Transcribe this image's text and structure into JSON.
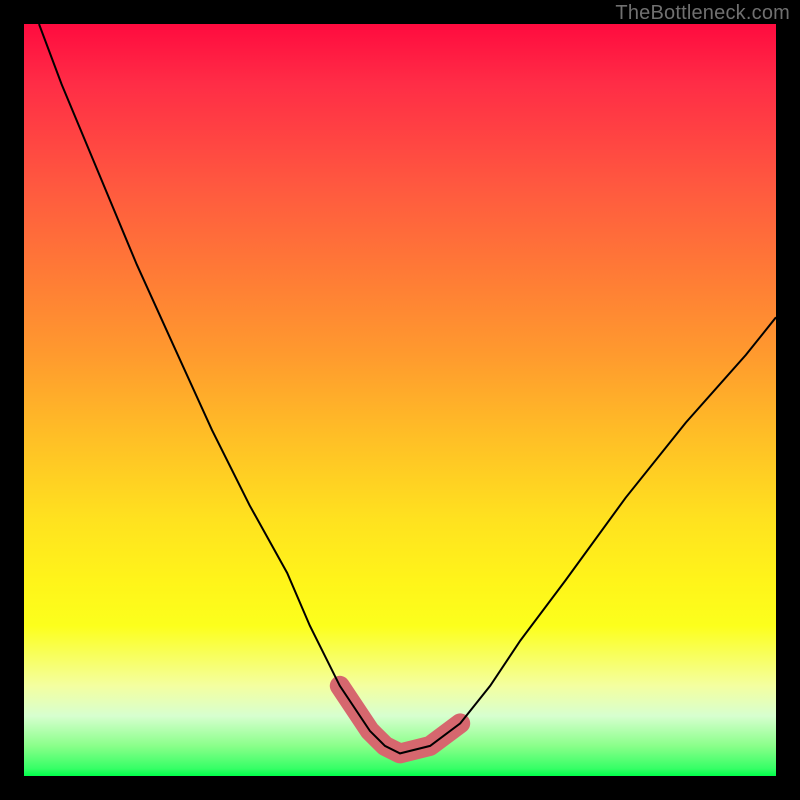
{
  "attribution": "TheBottleneck.com",
  "chart_data": {
    "type": "line",
    "title": "",
    "xlabel": "",
    "ylabel": "",
    "xlim": [
      0,
      100
    ],
    "ylim": [
      0,
      100
    ],
    "series": [
      {
        "name": "bottleneck-curve",
        "color": "#000000",
        "x": [
          2,
          5,
          10,
          15,
          20,
          25,
          30,
          35,
          38,
          42,
          46,
          48,
          50,
          54,
          58,
          62,
          66,
          72,
          80,
          88,
          96,
          100
        ],
        "y": [
          100,
          92,
          80,
          68,
          57,
          46,
          36,
          27,
          20,
          12,
          6,
          4,
          3,
          4,
          7,
          12,
          18,
          26,
          37,
          47,
          56,
          61
        ]
      }
    ],
    "annotations": [
      {
        "name": "valley-highlight",
        "color": "#d6676e",
        "x": [
          42,
          46,
          48,
          50,
          54,
          58
        ],
        "y": [
          12,
          6,
          4,
          3,
          4,
          7
        ]
      }
    ],
    "background_gradient": {
      "direction": "top-to-bottom",
      "stops": [
        {
          "pct": 0,
          "color": "#ff0b3f"
        },
        {
          "pct": 22,
          "color": "#ff5a3f"
        },
        {
          "pct": 44,
          "color": "#ff9a2e"
        },
        {
          "pct": 66,
          "color": "#ffe21f"
        },
        {
          "pct": 88,
          "color": "#f4ffa0"
        },
        {
          "pct": 100,
          "color": "#00ff4a"
        }
      ]
    }
  }
}
